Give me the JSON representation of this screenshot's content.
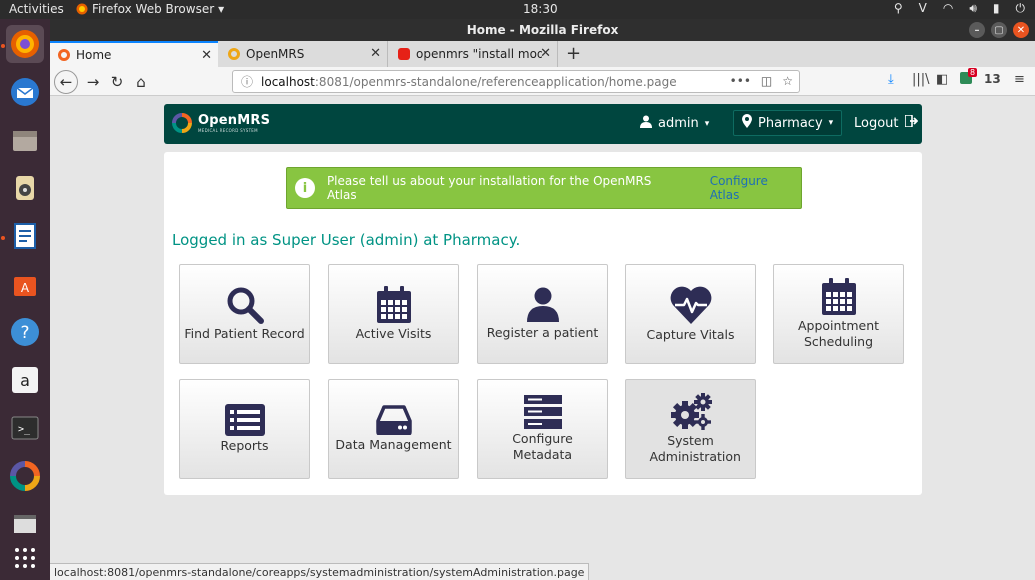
{
  "topbar": {
    "activities": "Activities",
    "app_menu": "Firefox Web Browser",
    "clock": "18:30"
  },
  "window": {
    "title": "Home - Mozilla Firefox"
  },
  "tabs": [
    {
      "label": "Home",
      "active": true
    },
    {
      "label": "OpenMRS",
      "active": false
    },
    {
      "label": "openmrs \"install module",
      "active": false
    }
  ],
  "navbar": {
    "url_host": "localhost",
    "url_rest": ":8081/openmrs-standalone/referenceapplication/home.page",
    "badge_count": "8",
    "counter": "13"
  },
  "header": {
    "brand": "OpenMRS",
    "brand_sub": "MEDICAL RECORD SYSTEM",
    "user": "admin",
    "location": "Pharmacy",
    "logout": "Logout"
  },
  "atlas": {
    "message": "Please tell us about your installation for the OpenMRS Atlas",
    "link": "Configure Atlas"
  },
  "greeting": "Logged in as Super User (admin) at Pharmacy.",
  "apps": [
    {
      "label": "Find Patient Record",
      "icon": "search-icon"
    },
    {
      "label": "Active Visits",
      "icon": "calendar-icon"
    },
    {
      "label": "Register a patient",
      "icon": "user-icon"
    },
    {
      "label": "Capture Vitals",
      "icon": "heart-pulse-icon"
    },
    {
      "label": "Appointment Scheduling",
      "icon": "calendar-icon"
    },
    {
      "label": "Reports",
      "icon": "list-icon"
    },
    {
      "label": "Data Management",
      "icon": "hard-drive-icon"
    },
    {
      "label": "Configure Metadata",
      "icon": "server-icon"
    },
    {
      "label": "System Administration",
      "icon": "gears-icon"
    }
  ],
  "statusbar": "localhost:8081/openmrs-standalone/coreapps/systemadministration/systemAdministration.page",
  "colors": {
    "header_bg": "#00463f",
    "atlas_bg": "#88c541",
    "greeting": "#009384",
    "icon": "#2e2d55"
  }
}
